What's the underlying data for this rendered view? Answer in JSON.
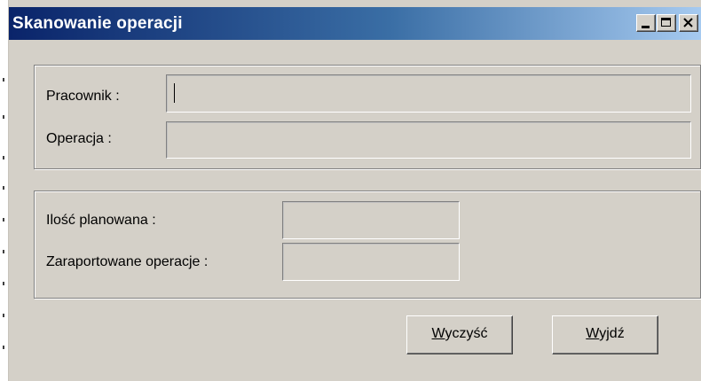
{
  "window": {
    "title": "Skanowanie operacji",
    "controls": {
      "minimize": "_",
      "maximize": "□",
      "close": "×"
    }
  },
  "group_top": {
    "pracownik_label": "Pracownik :",
    "pracownik_value": "",
    "operacja_label": "Operacja :",
    "operacja_value": ""
  },
  "group_bottom": {
    "ilosc_label": "Ilość planowana :",
    "ilosc_value": "",
    "zaraportowane_label": "Zaraportowane operacje :",
    "zaraportowane_value": ""
  },
  "buttons": {
    "wyczysc": {
      "accel": "W",
      "rest": "yczyść"
    },
    "wyjdz": {
      "accel": "W",
      "rest": "yjdź"
    }
  },
  "colors": {
    "titlebar_start": "#0a246a",
    "titlebar_end": "#a6caf0",
    "face": "#d4d0c8"
  }
}
